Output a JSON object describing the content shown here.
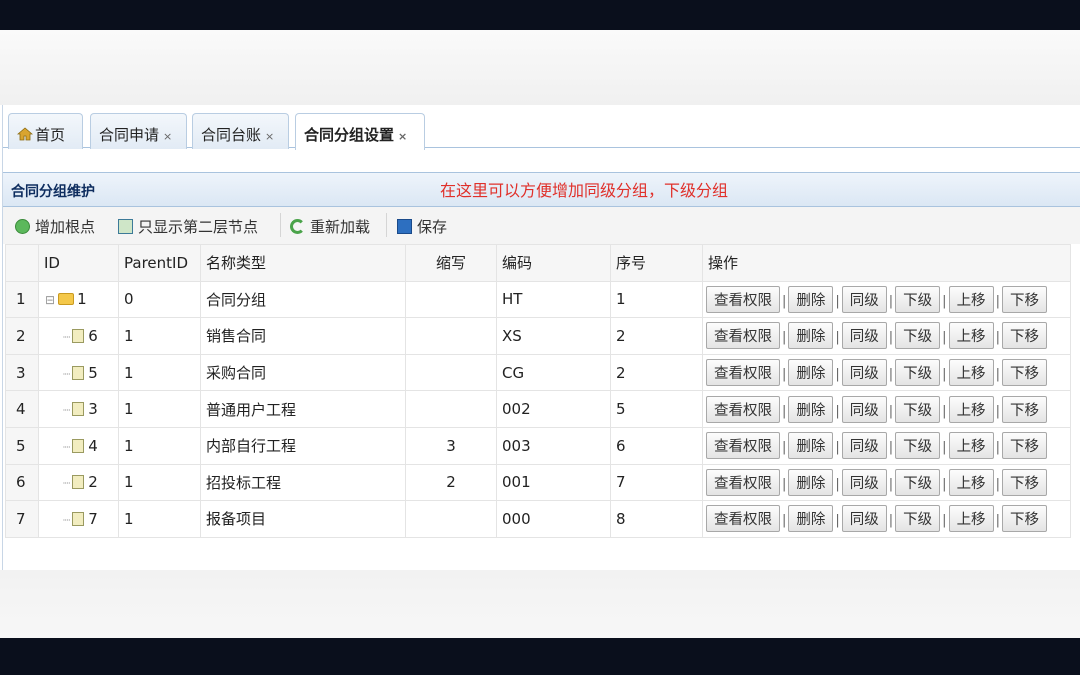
{
  "tabs": [
    {
      "label": "首页",
      "icon": "home-icon"
    },
    {
      "label": "合同申请"
    },
    {
      "label": "合同台账"
    },
    {
      "label": "合同分组设置",
      "active": true
    }
  ],
  "close_glyph": "×",
  "panel": {
    "title": "合同分组维护",
    "note": "在这里可以方便增加同级分组，下级分组"
  },
  "toolbar": {
    "add_root": "增加根点",
    "show_second": "只显示第二层节点",
    "reload": "重新加载",
    "save": "保存"
  },
  "columns": [
    "ID",
    "ParentID",
    "名称类型",
    "缩写",
    "编码",
    "序号",
    "操作"
  ],
  "actions": [
    "查看权限",
    "删除",
    "同级",
    "下级",
    "上移",
    "下移"
  ],
  "rows": [
    {
      "n": "1",
      "id": "1",
      "pid": "0",
      "name": "合同分组",
      "abbr": "",
      "code": "HT",
      "seq": "1",
      "type": "folder"
    },
    {
      "n": "2",
      "id": "6",
      "pid": "1",
      "name": "销售合同",
      "abbr": "",
      "code": "XS",
      "seq": "2",
      "type": "file"
    },
    {
      "n": "3",
      "id": "5",
      "pid": "1",
      "name": "采购合同",
      "abbr": "",
      "code": "CG",
      "seq": "2",
      "type": "file"
    },
    {
      "n": "4",
      "id": "3",
      "pid": "1",
      "name": "普通用户工程",
      "abbr": "",
      "code": "002",
      "seq": "5",
      "type": "file"
    },
    {
      "n": "5",
      "id": "4",
      "pid": "1",
      "name": "内部自行工程",
      "abbr": "3",
      "code": "003",
      "seq": "6",
      "type": "file"
    },
    {
      "n": "6",
      "id": "2",
      "pid": "1",
      "name": "招投标工程",
      "abbr": "2",
      "code": "001",
      "seq": "7",
      "type": "file"
    },
    {
      "n": "7",
      "id": "7",
      "pid": "1",
      "name": "报备项目",
      "abbr": "",
      "code": "000",
      "seq": "8",
      "type": "file"
    }
  ],
  "colors": {
    "note": "#e0302a",
    "title": "#0e2d5f"
  }
}
